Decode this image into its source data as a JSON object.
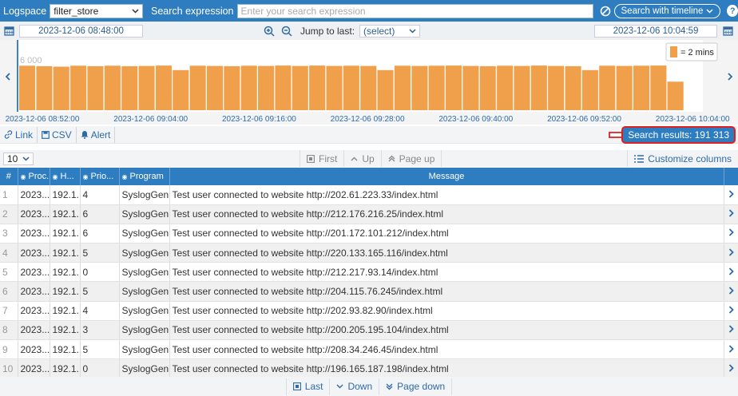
{
  "top": {
    "logspace_label": "Logspace",
    "logspace_value": "filter_store",
    "search_label": "Search expression",
    "search_placeholder": "Enter your search expression",
    "search_timeline_label": "Search with timeline",
    "help_glyph": "?"
  },
  "time": {
    "start": "2023-12-06 08:48:00",
    "end": "2023-12-06 10:04:59",
    "jump_label": "Jump to last:",
    "jump_value": "(select)"
  },
  "chart_data": {
    "type": "bar",
    "ylim": [
      0,
      8000
    ],
    "y_tick_label": "6 000",
    "y_tick_value": 6000,
    "legend_label": "= 2 mins",
    "bar_color": "#f0a04b",
    "values": [
      4600,
      4550,
      4500,
      4600,
      4550,
      4600,
      4550,
      4580,
      4620,
      4150,
      4600,
      4580,
      4550,
      4600,
      4580,
      4620,
      4580,
      4620,
      4580,
      4600,
      4580,
      4150,
      4600,
      4580,
      4600,
      4620,
      4580,
      4550,
      4600,
      4580,
      4620,
      4580,
      4550,
      4150,
      4600,
      4580,
      4600,
      4620,
      2950
    ],
    "x_tick_labels": [
      "2023-12-06 08:52:00",
      "2023-12-06 09:04:00",
      "2023-12-06 09:16:00",
      "2023-12-06 09:28:00",
      "2023-12-06 09:40:00",
      "2023-12-06 09:52:00",
      "2023-12-06 10:04:00"
    ]
  },
  "toolbar": {
    "link": "Link",
    "csv": "CSV",
    "alert": "Alert",
    "results": "Search results: 191 313"
  },
  "paging": {
    "page_size": "10",
    "first": "First",
    "up": "Up",
    "page_up": "Page up",
    "customize": "Customize columns",
    "last": "Last",
    "down": "Down",
    "page_down": "Page down"
  },
  "table": {
    "headers": [
      "#",
      "Proc...",
      "H...",
      "Prio...",
      "Program",
      "Message"
    ],
    "rows": [
      {
        "n": "1",
        "proc": "2023...",
        "host": "192.1...",
        "prio": "4",
        "prog": "SyslogGen",
        "msg": "Test user connected to website http://202.61.223.33/index.html"
      },
      {
        "n": "2",
        "proc": "2023...",
        "host": "192.1...",
        "prio": "6",
        "prog": "SyslogGen",
        "msg": "Test user connected to website http://212.176.216.25/index.html"
      },
      {
        "n": "3",
        "proc": "2023...",
        "host": "192.1...",
        "prio": "6",
        "prog": "SyslogGen",
        "msg": "Test user connected to website http://201.172.101.212/index.html"
      },
      {
        "n": "4",
        "proc": "2023...",
        "host": "192.1...",
        "prio": "5",
        "prog": "SyslogGen",
        "msg": "Test user connected to website http://220.133.165.116/index.html"
      },
      {
        "n": "5",
        "proc": "2023...",
        "host": "192.1...",
        "prio": "0",
        "prog": "SyslogGen",
        "msg": "Test user connected to website http://212.217.93.14/index.html"
      },
      {
        "n": "6",
        "proc": "2023...",
        "host": "192.1...",
        "prio": "5",
        "prog": "SyslogGen",
        "msg": "Test user connected to website http://204.115.76.245/index.html"
      },
      {
        "n": "7",
        "proc": "2023...",
        "host": "192.1...",
        "prio": "4",
        "prog": "SyslogGen",
        "msg": "Test user connected to website http://202.93.82.90/index.html"
      },
      {
        "n": "8",
        "proc": "2023...",
        "host": "192.1...",
        "prio": "3",
        "prog": "SyslogGen",
        "msg": "Test user connected to website http://200.205.195.104/index.html"
      },
      {
        "n": "9",
        "proc": "2023...",
        "host": "192.1...",
        "prio": "5",
        "prog": "SyslogGen",
        "msg": "Test user connected to website http://208.34.246.45/index.html"
      },
      {
        "n": "10",
        "proc": "2023...",
        "host": "192.1...",
        "prio": "0",
        "prog": "SyslogGen",
        "msg": "Test user connected to website http://196.165.187.198/index.html"
      }
    ]
  }
}
